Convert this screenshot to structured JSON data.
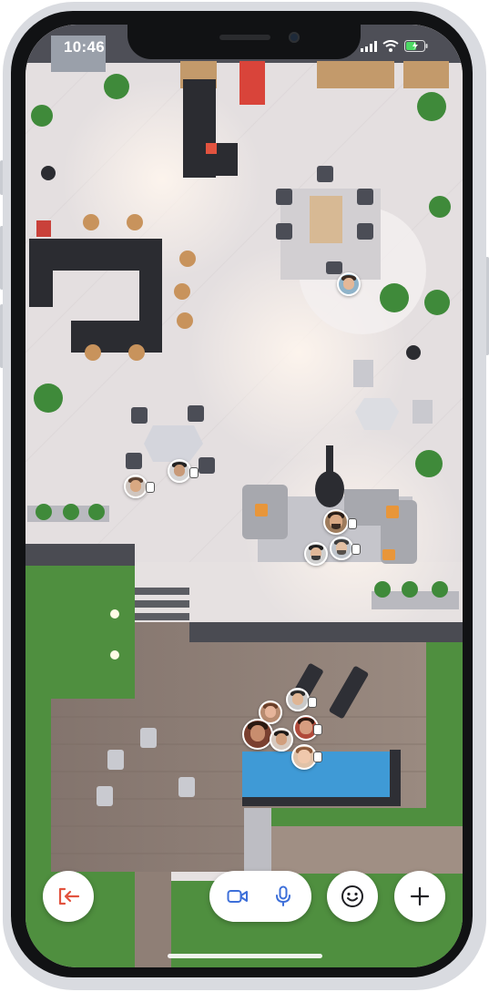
{
  "status_bar": {
    "time": "10:46",
    "icons": [
      "signal-icon",
      "wifi-icon",
      "battery-charging-icon"
    ]
  },
  "toolbar": {
    "leave_icon": "leave-icon",
    "camera_icon": "video-camera-icon",
    "mic_icon": "microphone-icon",
    "reactions_icon": "smiley-icon",
    "add_icon": "plus-icon"
  },
  "colors": {
    "floor": "#e6e1e1",
    "grass": "#4f8f3f",
    "deck": "#8a7a72",
    "pool": "#3f9ad6",
    "accent_red": "#e2533f",
    "icon_blue": "#3d6fd9"
  },
  "participants": [
    {
      "name": "participant-avatar-1"
    },
    {
      "name": "participant-avatar-2"
    },
    {
      "name": "participant-avatar-3"
    },
    {
      "name": "participant-avatar-4"
    },
    {
      "name": "participant-avatar-5"
    },
    {
      "name": "participant-avatar-6"
    },
    {
      "name": "participant-avatar-7"
    },
    {
      "name": "participant-avatar-8"
    },
    {
      "name": "participant-avatar-9"
    },
    {
      "name": "participant-avatar-10"
    },
    {
      "name": "participant-avatar-11"
    }
  ]
}
